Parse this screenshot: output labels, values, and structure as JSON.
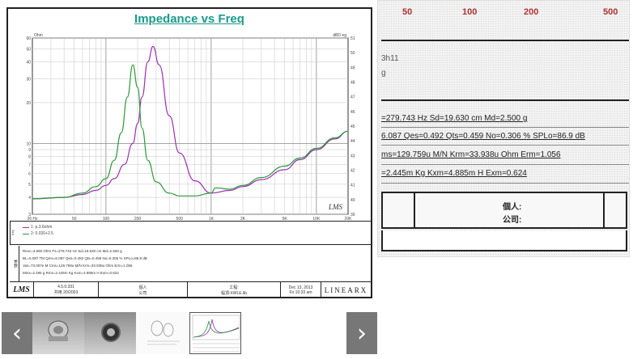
{
  "chart": {
    "title": "Impedance vs Freq",
    "left_unit": "Ohm",
    "right_unit": "dBD eg",
    "left_ticks": [
      "60",
      "50",
      "40",
      "30",
      "20",
      "10",
      "9",
      "8",
      "7",
      "6",
      "5",
      "4",
      "3"
    ],
    "right_ticks": [
      "51",
      "50",
      "49",
      "48",
      "47",
      "46",
      "45",
      "44",
      "43",
      "42",
      "41",
      "40",
      "39"
    ],
    "x_ticks": [
      "20 Hz",
      "50",
      "100",
      "200",
      "500",
      "1K",
      "2K",
      "5K",
      "10K",
      "20K"
    ],
    "watermark": "LMS",
    "series_colors": [
      "#9b2fae",
      "#2a9a3a"
    ]
  },
  "chart_data": {
    "type": "line",
    "title": "Impedance vs Freq",
    "xlabel": "",
    "ylabel": "Ohm",
    "x_scale": "log",
    "y_scale": "log",
    "xlim": [
      20,
      20000
    ],
    "ylim": [
      3,
      60
    ],
    "grid": true,
    "series": [
      {
        "name": "1: p.3.6ohm",
        "x": [
          20,
          40,
          60,
          80,
          100,
          120,
          150,
          180,
          200,
          220,
          250,
          280,
          320,
          400,
          500,
          700,
          1000,
          1500,
          2000,
          3000,
          5000,
          7000,
          10000,
          15000,
          20000
        ],
        "y": [
          3.9,
          4.0,
          4.2,
          4.5,
          4.9,
          5.5,
          7.0,
          10.0,
          14.0,
          22.0,
          40.0,
          52.0,
          38.0,
          16.0,
          8.5,
          5.3,
          4.3,
          4.5,
          4.8,
          5.4,
          6.4,
          7.6,
          9.0,
          10.8,
          12.3
        ]
      },
      {
        "name": "2: 0.020+2.5",
        "x": [
          20,
          40,
          60,
          80,
          100,
          120,
          140,
          160,
          180,
          200,
          220,
          250,
          300,
          400,
          500,
          700,
          1000,
          1100,
          1500,
          2000,
          3000,
          5000,
          7000,
          10000,
          15000,
          20000
        ],
        "y": [
          3.9,
          4.0,
          4.3,
          4.8,
          5.5,
          7.5,
          12.0,
          22.0,
          38.0,
          26.0,
          13.0,
          7.5,
          5.2,
          4.3,
          4.1,
          4.1,
          4.3,
          4.7,
          4.6,
          4.9,
          5.6,
          6.8,
          7.8,
          9.2,
          11.0,
          12.3
        ]
      }
    ]
  },
  "legend": {
    "side": "Key",
    "row1": "1: p.3.6ohm",
    "row2": "2: 0.020+2.5"
  },
  "params": {
    "side": "参数",
    "line1": "Revc=3.690 Ohm Fs=279.743 Hz  Sd=19.630 cm  Md=2.500 g",
    "line2": "BL=5.087 TM Qms=6.087  Qes=0.492  Qts=0.459  No=0.306 %  SPLo=86.9 dB",
    "line3": "Vas=73.007e M  Cms=129.759u M/N  Krm=33.938u Ohm  Erm=1.056",
    "line4": "Mms=2.495 g Rms=2.445m Kg  Kxm=4.885m H  Exm=0.624"
  },
  "footer": {
    "logo": "LMS",
    "version": "4.5.0.331",
    "version_date": "共用 20/2003",
    "person_label": "個人",
    "company_label": "公司",
    "project_label": "工程:",
    "project_value": "幅頂:XWLE.lib",
    "date": "Dec 13, 2013",
    "time": "Fri 10:33 am",
    "brand": "LINEARX"
  },
  "zoom": {
    "ticks": [
      "50",
      "100",
      "200",
      "500"
    ],
    "side1": "3h11",
    "side2": "g",
    "line1": "=279.743 Hz  Sd=19.630 cm  Md=2.500 g",
    "line2": "6.087  Qes=0.492  Qts=0.459  No=0.306 %  SPLo=86.9 dB",
    "line3": "ms=129.759u M/N  Krm=33.938u Ohm  Erm=1.056",
    "line4": "=2.445m Kg  Kxm=4.885m H  Exm=0.624",
    "person": "個人:",
    "company": "公司:"
  },
  "carousel": {
    "prev": "‹",
    "next": "›",
    "thumbnails": [
      "speaker-front-thumbnail",
      "speaker-back-thumbnail",
      "drawing-thumbnail",
      "chart-thumbnail"
    ]
  }
}
